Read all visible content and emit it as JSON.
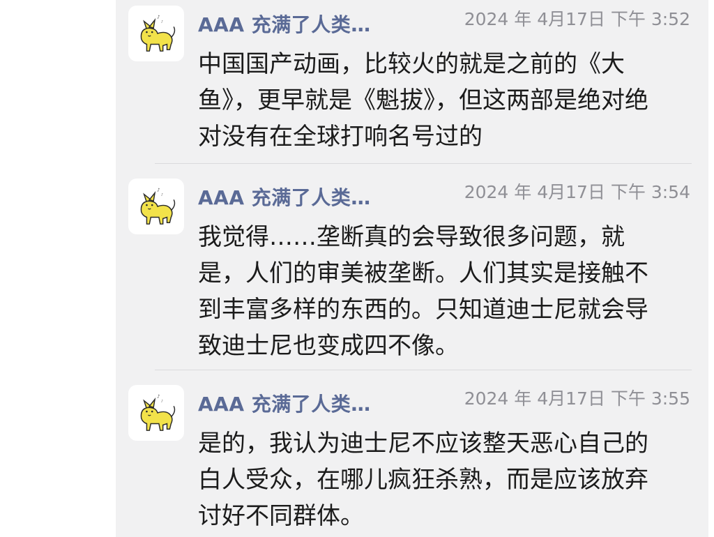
{
  "messages": [
    {
      "author": "AAA 充满了人类…",
      "time": "2024 年 4月17日 下午 3:52",
      "text": "中国国产动画，比较火的就是之前的《大鱼》，更早就是《魁拔》，但这两部是绝对绝对没有在全球打响名号过的",
      "avatar_icon": "yellow-cat-icon"
    },
    {
      "author": "AAA 充满了人类…",
      "time": "2024 年 4月17日 下午 3:54",
      "text": "我觉得……垄断真的会导致很多问题，就是，人们的审美被垄断。人们其实是接触不到丰富多样的东西的。只知道迪士尼就会导致迪士尼也变成四不像。",
      "avatar_icon": "yellow-cat-icon"
    },
    {
      "author": "AAA 充满了人类…",
      "time": "2024 年 4月17日 下午 3:55",
      "text": "是的，我认为迪士尼不应该整天恶心自己的白人受众，在哪儿疯狂杀熟，而是应该放弃讨好不同群体。",
      "avatar_icon": "yellow-cat-icon"
    }
  ],
  "colors": {
    "panel_bg": "#f1f1f2",
    "author": "#5a6a96",
    "timestamp": "#8f8f95",
    "cat_yellow": "#f2e24a"
  }
}
